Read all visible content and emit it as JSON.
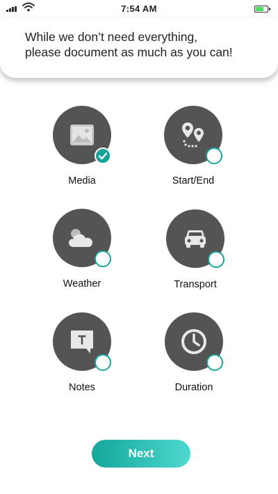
{
  "status_bar": {
    "time": "7:54 AM",
    "battery_level": 0.75,
    "battery_color": "#4cd964"
  },
  "header": {
    "instruction": "While we don’t need everything,\nplease document as much as you can!"
  },
  "options": [
    {
      "label": "Media",
      "icon": "image-icon",
      "checked": true
    },
    {
      "label": "Start/End",
      "icon": "location-pins-icon",
      "checked": false
    },
    {
      "label": "Weather",
      "icon": "cloud-icon",
      "checked": false
    },
    {
      "label": "Transport",
      "icon": "car-icon",
      "checked": false
    },
    {
      "label": "Notes",
      "icon": "note-icon",
      "checked": false
    },
    {
      "label": "Duration",
      "icon": "clock-icon",
      "checked": false
    }
  ],
  "accent_color": "#18a398",
  "next_button": {
    "label": "Next"
  }
}
